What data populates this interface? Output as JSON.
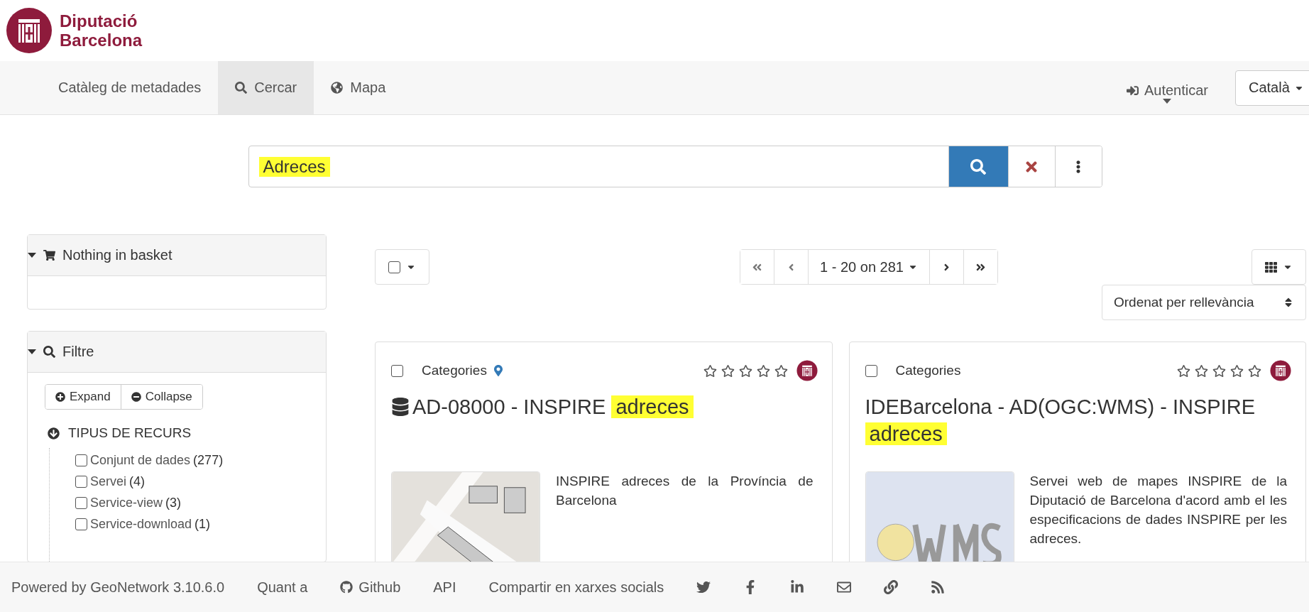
{
  "logo": {
    "lines": [
      "Diputació",
      "Barcelona"
    ]
  },
  "nav": {
    "items": [
      {
        "label": "Catàleg de metadades",
        "selected": false
      },
      {
        "label": "Cercar",
        "selected": true
      },
      {
        "label": "Mapa",
        "selected": false
      }
    ],
    "login": "Autenticar",
    "language": "Català"
  },
  "search": {
    "value": "Adreces",
    "highlighted": true
  },
  "basket": {
    "title": "Nothing in basket",
    "expanded": true
  },
  "filter": {
    "title": "Filtre",
    "expanded": true,
    "expand_label": "Expand",
    "collapse_label": "Collapse",
    "facet": {
      "title": "TIPUS DE RECURS",
      "expanded": true,
      "items": [
        {
          "label": "Conjunt de dades",
          "count": "(277)",
          "checked": false
        },
        {
          "label": "Servei",
          "count": "(4)",
          "checked": false
        },
        {
          "label": "Service-view",
          "count": "(3)",
          "checked": false
        },
        {
          "label": "Service-download",
          "count": "(1)",
          "checked": false
        }
      ]
    }
  },
  "results": {
    "select_all_checked": false,
    "pagination": "1 - 20 on 281",
    "sort": "Ordenat per rellevància",
    "cards": [
      {
        "kind": "dataset",
        "checked": false,
        "categories": "Categories",
        "geolocated": true,
        "stars": 0,
        "title": [
          {
            "text": "AD-08000 - INSPIRE ",
            "highlighted": false
          },
          {
            "text": "adreces",
            "highlighted": true
          }
        ],
        "description": "INSPIRE adreces de la Província de Barcelona"
      },
      {
        "kind": "service",
        "checked": false,
        "categories": "Categories",
        "geolocated": false,
        "stars": 0,
        "title": [
          {
            "text": "IDEBarcelona - AD(OGC:WMS) - INSPIRE ",
            "highlighted": false
          },
          {
            "text": "adreces",
            "highlighted": true
          }
        ],
        "description": "Servei web de mapes INSPIRE de la Diputació de Barcelona d'acord amb el les especificacions de dades INSPIRE per les adreces."
      }
    ]
  },
  "footer": {
    "powered": "Powered by GeoNetwork 3.10.6.0",
    "links": [
      "Quant a",
      "Github",
      "API"
    ],
    "share": "Compartir en xarxes socials"
  }
}
